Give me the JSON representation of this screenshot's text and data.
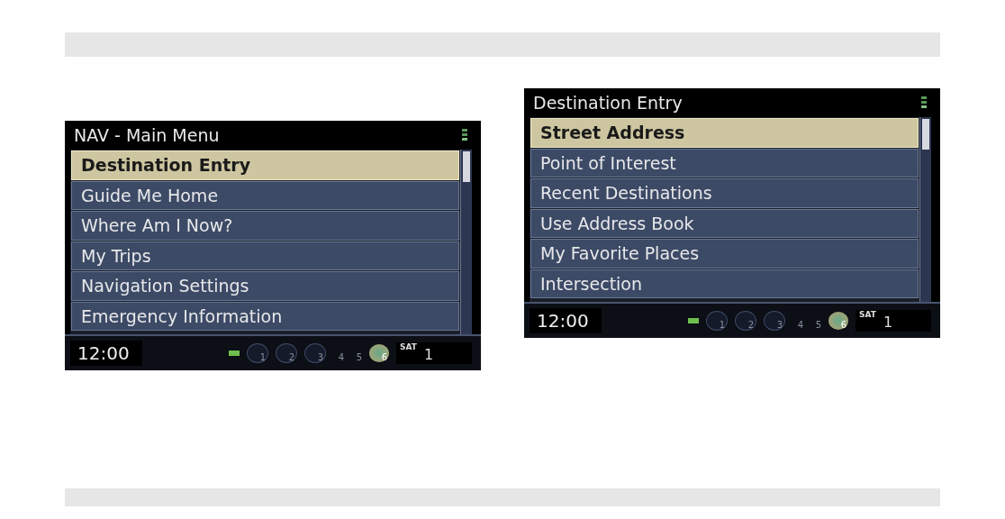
{
  "screens": [
    {
      "title": "NAV - Main Menu",
      "items": [
        {
          "label": "Destination Entry",
          "selected": true
        },
        {
          "label": "Guide Me Home",
          "selected": false
        },
        {
          "label": "Where Am I Now?",
          "selected": false
        },
        {
          "label": "My Trips",
          "selected": false
        },
        {
          "label": "Navigation Settings",
          "selected": false
        },
        {
          "label": "Emergency Information",
          "selected": false
        }
      ],
      "status": {
        "time": "12:00",
        "slots": [
          "1",
          "2",
          "3",
          "4",
          "5",
          "6"
        ],
        "band": "SAT",
        "preset": "1"
      }
    },
    {
      "title": "Destination Entry",
      "items": [
        {
          "label": "Street Address",
          "selected": true
        },
        {
          "label": "Point of Interest",
          "selected": false
        },
        {
          "label": "Recent Destinations",
          "selected": false
        },
        {
          "label": "Use Address Book",
          "selected": false
        },
        {
          "label": "My Favorite Places",
          "selected": false
        },
        {
          "label": "Intersection",
          "selected": false
        }
      ],
      "status": {
        "time": "12:00",
        "slots": [
          "1",
          "2",
          "3",
          "4",
          "5",
          "6"
        ],
        "band": "SAT",
        "preset": "1"
      }
    }
  ]
}
